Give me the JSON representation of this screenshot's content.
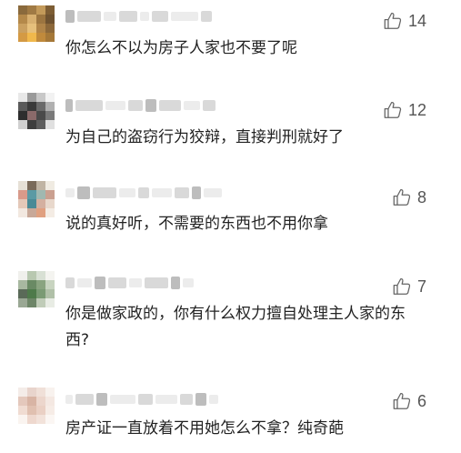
{
  "colors": {
    "text": "#222222",
    "count": "#555555",
    "icon": "#666666",
    "blur": "#d9d9d9"
  },
  "icons": {
    "like": "thumbs-up-icon"
  },
  "comments": [
    {
      "likes": "14",
      "text": "你怎么不以为房子人家也不要了呢"
    },
    {
      "likes": "12",
      "text": "为自己的盗窃行为狡辩，直接判刑就好了"
    },
    {
      "likes": "8",
      "text": "说的真好听，不需要的东西也不用你拿"
    },
    {
      "likes": "7",
      "text": "你是做家政的，你有什么权力擅自处理主人家的东西?"
    },
    {
      "likes": "6",
      "text": "房产证一直放着不用她怎么不拿？纯奇葩"
    }
  ]
}
